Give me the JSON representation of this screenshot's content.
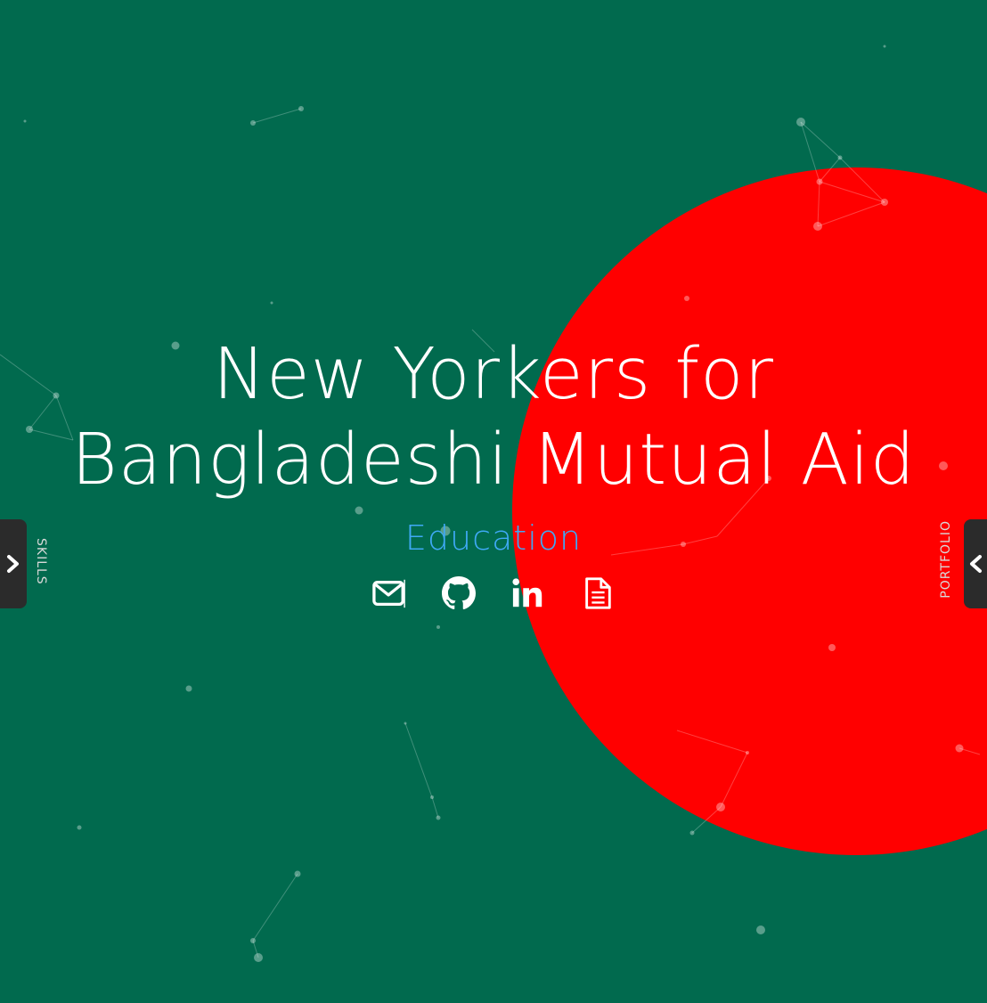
{
  "hero": {
    "title_line1": "New Yorkers for",
    "title_line2": "Bangladeshi Mutual Aid",
    "subtitle": "Education"
  },
  "social": [
    {
      "name": "email-icon"
    },
    {
      "name": "github-icon"
    },
    {
      "name": "linkedin-icon"
    },
    {
      "name": "resume-icon"
    }
  ],
  "nav": {
    "left_label": "SKILLS",
    "right_label": "PORTFOLIO"
  },
  "colors": {
    "background": "#006a4e",
    "sun": "#ff0000",
    "subtitle": "#3fa9f5",
    "text": "#ffffff",
    "tab": "#2b2b2b"
  }
}
